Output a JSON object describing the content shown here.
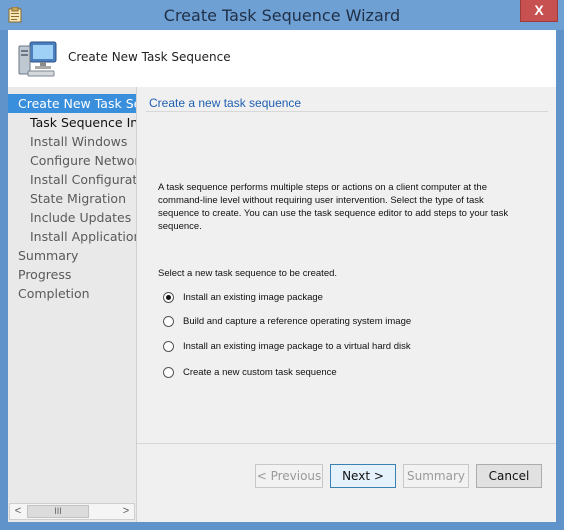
{
  "window": {
    "title": "Create Task Sequence Wizard",
    "close_glyph": "X"
  },
  "header": {
    "text": "Create New Task Sequence",
    "icon": "computer-icon"
  },
  "nav": {
    "items": [
      {
        "label": "Create New Task Sequence",
        "state": "active"
      },
      {
        "label": "Task Sequence Information",
        "state": "current"
      },
      {
        "label": "Install Windows",
        "state": "normal"
      },
      {
        "label": "Configure Network",
        "state": "normal"
      },
      {
        "label": "Install Configuration Manager",
        "state": "normal"
      },
      {
        "label": "State Migration",
        "state": "normal"
      },
      {
        "label": "Include Updates",
        "state": "normal"
      },
      {
        "label": "Install Applications",
        "state": "normal"
      },
      {
        "label": "Summary",
        "state": "normal"
      },
      {
        "label": "Progress",
        "state": "normal"
      },
      {
        "label": "Completion",
        "state": "normal"
      }
    ],
    "scroll_left": "<",
    "scroll_right": ">",
    "scroll_thumb": "III"
  },
  "main": {
    "heading": "Create a new task sequence",
    "description": "A task sequence performs multiple steps or actions on a client computer at the command-line level without requiring user intervention. Select the type of task sequence to create. You can use the task sequence editor to add steps to your task sequence.",
    "prompt": "Select a new task sequence to be created.",
    "options": [
      {
        "label": "Install an existing image package",
        "selected": true
      },
      {
        "label": "Build and capture a reference operating system image",
        "selected": false
      },
      {
        "label": "Install an existing image package to a virtual hard disk",
        "selected": false
      },
      {
        "label": "Create a new custom task sequence",
        "selected": false
      }
    ]
  },
  "buttons": {
    "previous": "< Previous",
    "next": "Next >",
    "summary": "Summary",
    "cancel": "Cancel"
  },
  "colors": {
    "accent": "#3a8fdc",
    "title_bar": "#6fa0d4",
    "close": "#c75050",
    "heading": "#1f5fb2"
  }
}
